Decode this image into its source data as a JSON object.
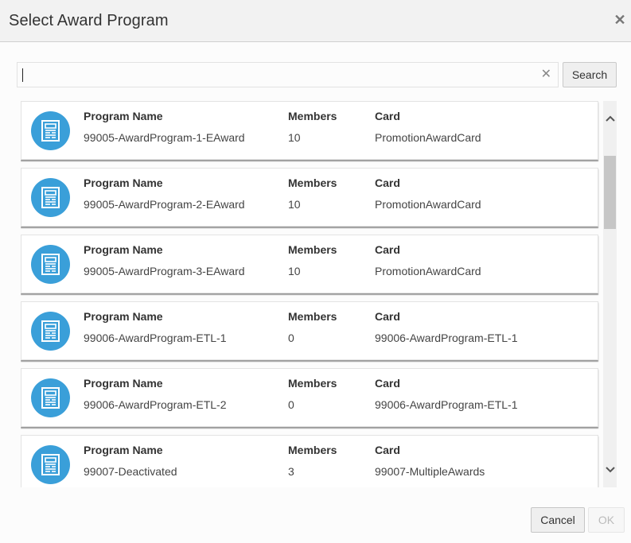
{
  "dialog": {
    "title": "Select Award Program",
    "close_icon": "close-icon"
  },
  "search": {
    "value": "",
    "placeholder": "",
    "clear_icon": "clear-icon",
    "button_label": "Search"
  },
  "columns": {
    "name": "Program Name",
    "members": "Members",
    "card": "Card"
  },
  "programs": [
    {
      "icon": "document-icon",
      "name": "99005-AwardProgram-1-EAward",
      "members": "10",
      "card": "PromotionAwardCard"
    },
    {
      "icon": "document-icon",
      "name": "99005-AwardProgram-2-EAward",
      "members": "10",
      "card": "PromotionAwardCard"
    },
    {
      "icon": "document-icon",
      "name": "99005-AwardProgram-3-EAward",
      "members": "10",
      "card": "PromotionAwardCard"
    },
    {
      "icon": "document-icon",
      "name": "99006-AwardProgram-ETL-1",
      "members": "0",
      "card": "99006-AwardProgram-ETL-1"
    },
    {
      "icon": "document-icon",
      "name": "99006-AwardProgram-ETL-2",
      "members": "0",
      "card": "99006-AwardProgram-ETL-1"
    },
    {
      "icon": "document-icon",
      "name": "99007-Deactivated",
      "members": "3",
      "card": "99007-MultipleAwards"
    }
  ],
  "scrollbar": {
    "up_glyph": "⌃",
    "down_glyph": "⌄"
  },
  "footer": {
    "cancel_label": "Cancel",
    "ok_label": "OK",
    "ok_disabled": true
  },
  "colors": {
    "icon_bg": "#3a9fd9",
    "header_bg": "#f2f2f2"
  }
}
